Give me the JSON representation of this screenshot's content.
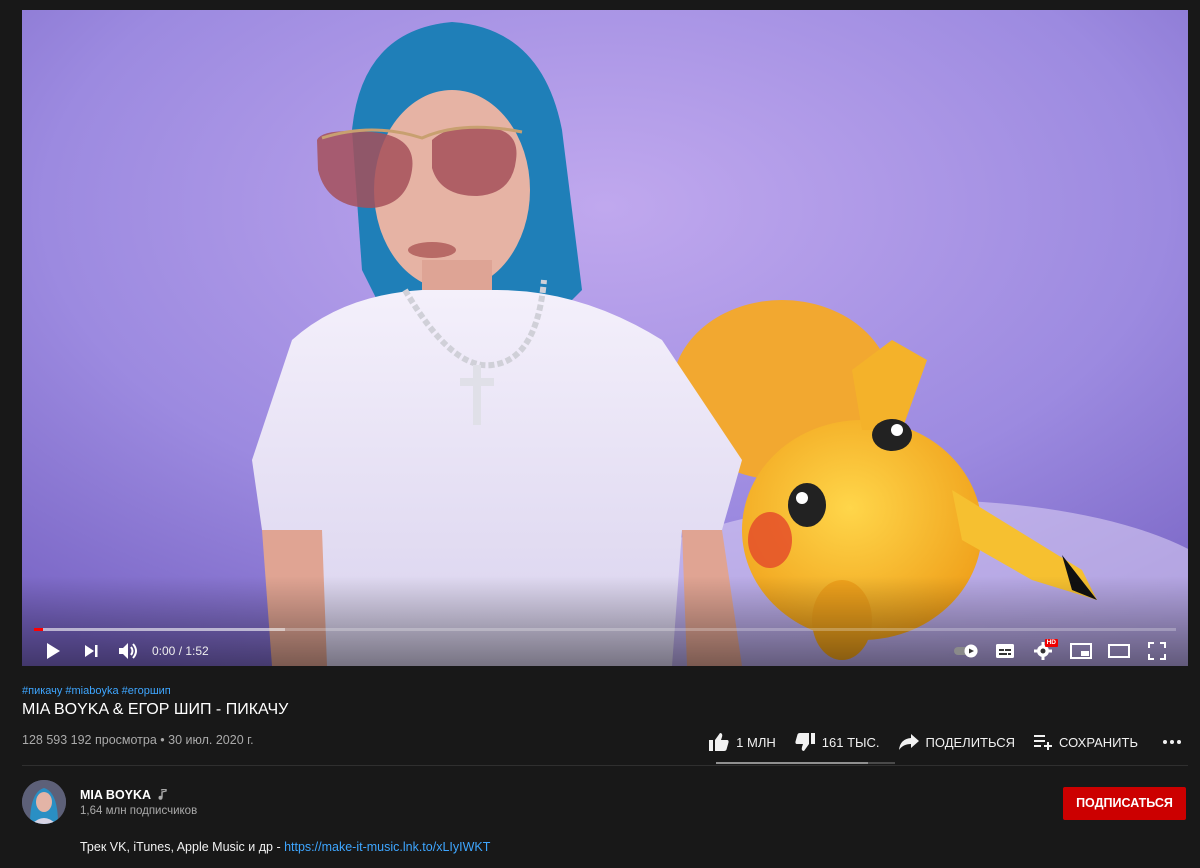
{
  "player": {
    "time_current": "0:00",
    "time_separator": " / ",
    "time_total": "1:52",
    "progress_played_fraction": 0.008,
    "progress_buffered_fraction": 0.22,
    "quality_badge": "HD",
    "icons": [
      "play-icon",
      "next-icon",
      "volume-icon",
      "autoplay-toggle-icon",
      "subtitles-icon",
      "settings-icon",
      "miniplayer-icon",
      "theater-mode-icon",
      "fullscreen-icon"
    ]
  },
  "video": {
    "hashtags": [
      "#пикачу",
      "#miaboyka",
      "#егоршип"
    ],
    "title": "MIA BOYKA & ЕГОР ШИП - ПИКАЧУ",
    "views": "128 593 192 просмотра",
    "meta_separator": " • ",
    "date": "30 июл. 2020 г."
  },
  "actions": {
    "like_count": "1 МЛН",
    "dislike_count": "161 ТЫС.",
    "share_label": "ПОДЕЛИТЬСЯ",
    "save_label": "СОХРАНИТЬ",
    "like_ratio": 0.85
  },
  "channel": {
    "name": "MIA BOYKA",
    "subscribers": "1,64 млн подписчиков",
    "subscribe_label": "ПОДПИСАТЬСЯ",
    "verified_icon": "music-note-icon"
  },
  "description": {
    "text": "Трек VK, iTunes, Apple Music и др - ",
    "link": "https://make-it-music.lnk.to/xLIyIWKT"
  },
  "colors": {
    "background": "#181818",
    "accent_red": "#cc0000",
    "progress_red": "#ff0000",
    "link_blue": "#3ea6ff",
    "muted_text": "#aaaaaa"
  }
}
